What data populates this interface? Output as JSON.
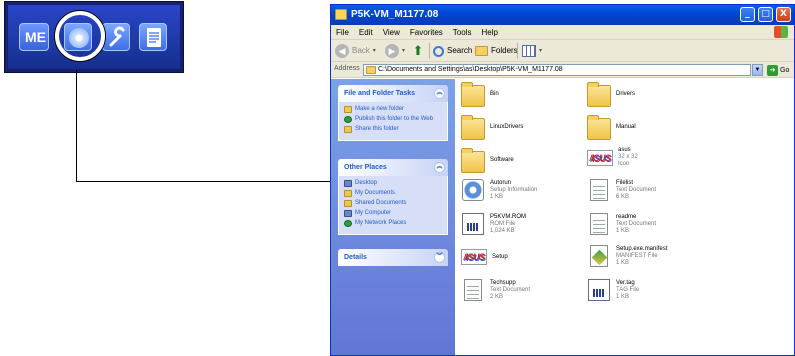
{
  "launcher": {
    "me_label": "ME",
    "icons": [
      "disc-icon",
      "wrench-icon",
      "document-icon"
    ]
  },
  "window": {
    "title": "P5K-VM_M1177.08",
    "controls": [
      "_",
      "□",
      "X"
    ],
    "menu": [
      "File",
      "Edit",
      "View",
      "Favorites",
      "Tools",
      "Help"
    ],
    "toolbar": {
      "back": "Back",
      "search": "Search",
      "folders": "Folders"
    },
    "address": {
      "label": "Address",
      "value": "C:\\Documents and Settings\\as\\Desktop\\P5K-VM_M1177.08",
      "go": "Go"
    }
  },
  "taskpane": {
    "file_tasks": {
      "title": "File and Folder Tasks",
      "items": [
        "Make a new folder",
        "Publish this folder to the Web",
        "Share this folder"
      ]
    },
    "other_places": {
      "title": "Other Places",
      "items": [
        "Desktop",
        "My Documents",
        "Shared Documents",
        "My Computer",
        "My Network Places"
      ]
    },
    "details": {
      "title": "Details"
    }
  },
  "files": [
    {
      "name": "Bin",
      "type": "",
      "size": "",
      "icon": "folder"
    },
    {
      "name": "Drivers",
      "type": "",
      "size": "",
      "icon": "folder"
    },
    {
      "name": "LinuxDrivers",
      "type": "",
      "size": "",
      "icon": "folder"
    },
    {
      "name": "Manual",
      "type": "",
      "size": "",
      "icon": "folder"
    },
    {
      "name": "Software",
      "type": "",
      "size": "",
      "icon": "folder"
    },
    {
      "name": "asus",
      "type": "32 x 32",
      "size": "Icon",
      "icon": "asus"
    },
    {
      "name": "Autorun",
      "type": "Setup Information",
      "size": "1 KB",
      "icon": "gear"
    },
    {
      "name": "Filelist",
      "type": "Text Document",
      "size": "6 KB",
      "icon": "doc"
    },
    {
      "name": "P5KVM.ROM",
      "type": "ROM File",
      "size": "1,024 KB",
      "icon": "rom"
    },
    {
      "name": "readme",
      "type": "Text Document",
      "size": "1 KB",
      "icon": "doc"
    },
    {
      "name": "Setup",
      "type": "",
      "size": "",
      "icon": "asus"
    },
    {
      "name": "Setup.exe.manifest",
      "type": "MANIFEST File",
      "size": "1 KB",
      "icon": "manifest"
    },
    {
      "name": "Techsupp",
      "type": "Text Document",
      "size": "2 KB",
      "icon": "doc"
    },
    {
      "name": "Ver.tag",
      "type": "TAG File",
      "size": "1 KB",
      "icon": "rom"
    }
  ]
}
